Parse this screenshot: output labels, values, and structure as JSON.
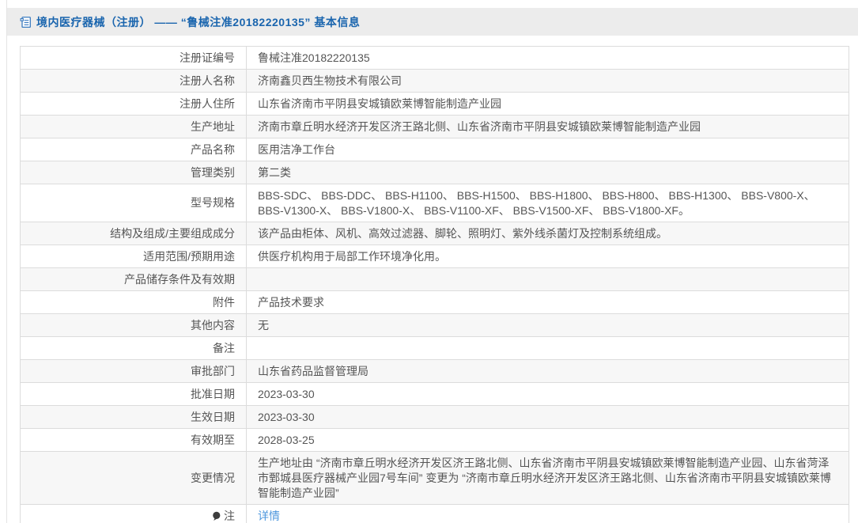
{
  "page": {
    "title": "境内医疗器械（注册） ——  “鲁械注准20182220135”  基本信息"
  },
  "icons": {
    "header": "document-icon",
    "note": "note-balloon-icon"
  },
  "colors": {
    "title_blue": "#1a65ae",
    "link_blue": "#4e97dd",
    "band_gray": "#ececec",
    "alt_row_gray": "#f7f7f7",
    "text_gray": "#555555"
  },
  "table": {
    "rows": [
      {
        "label": "注册证编号",
        "value": "鲁械注准20182220135"
      },
      {
        "label": "注册人名称",
        "value": "济南鑫贝西生物技术有限公司"
      },
      {
        "label": "注册人住所",
        "value": "山东省济南市平阴县安城镇欧莱博智能制造产业园"
      },
      {
        "label": "生产地址",
        "value": "济南市章丘明水经济开发区济王路北侧、山东省济南市平阴县安城镇欧莱博智能制造产业园"
      },
      {
        "label": "产品名称",
        "value": "医用洁净工作台"
      },
      {
        "label": "管理类别",
        "value": "第二类"
      },
      {
        "label": "型号规格",
        "value": "BBS-SDC、 BBS-DDC、 BBS-H1100、 BBS-H1500、 BBS-H1800、 BBS-H800、 BBS-H1300、 BBS-V800-X、 BBS-V1300-X、 BBS-V1800-X、 BBS-V1100-XF、 BBS-V1500-XF、 BBS-V1800-XF。"
      },
      {
        "label": "结构及组成/主要组成成分",
        "value": "该产品由柜体、风机、高效过滤器、脚轮、照明灯、紫外线杀菌灯及控制系统组成。"
      },
      {
        "label": "适用范围/预期用途",
        "value": "供医疗机构用于局部工作环境净化用。"
      },
      {
        "label": "产品储存条件及有效期",
        "value": ""
      },
      {
        "label": "附件",
        "value": "产品技术要求"
      },
      {
        "label": "其他内容",
        "value": "无"
      },
      {
        "label": "备注",
        "value": ""
      },
      {
        "label": "审批部门",
        "value": "山东省药品监督管理局"
      },
      {
        "label": "批准日期",
        "value": "2023-03-30"
      },
      {
        "label": "生效日期",
        "value": "2023-03-30"
      },
      {
        "label": "有效期至",
        "value": "2028-03-25"
      },
      {
        "label": "变更情况",
        "value": "生产地址由 “济南市章丘明水经济开发区济王路北侧、山东省济南市平阴县安城镇欧莱博智能制造产业园、山东省菏泽市鄄城县医疗器械产业园7号车间” 变更为 “济南市章丘明水经济开发区济王路北侧、山东省济南市平阴县安城镇欧莱博智能制造产业园”"
      },
      {
        "label": "注",
        "value": "详情"
      }
    ]
  }
}
